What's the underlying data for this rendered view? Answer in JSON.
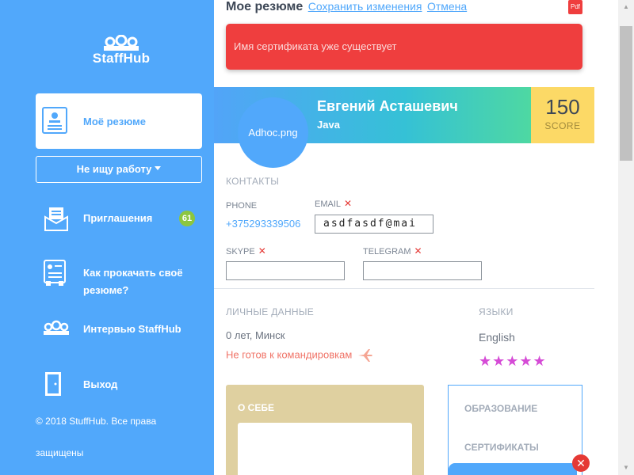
{
  "brand": {
    "name": "StaffHub"
  },
  "sidebar": {
    "items": [
      {
        "label": "Моё резюме",
        "icon": "resume-icon"
      },
      {
        "label": "Приглашения",
        "icon": "invitations-icon",
        "badge": "61"
      },
      {
        "label": "Как прокачать своё резюме?",
        "icon": "boost-resume-icon"
      },
      {
        "label": "Интервью StaffHub",
        "icon": "interview-icon"
      },
      {
        "label": "Выход",
        "icon": "exit-door-icon"
      }
    ],
    "status_select": "Не ищу работу",
    "footer": "© 2018 StuffHub. Все права защищены"
  },
  "header": {
    "title": "Мое резюме",
    "save_link": "Сохранить изменения",
    "cancel_link": "Отмена",
    "pdf_label": "Pdf"
  },
  "alert": {
    "message": "Имя сертификата уже существует"
  },
  "profile": {
    "avatar_text": "Adhoc.png",
    "name": "Евгений Асташевич",
    "specialty": "Java",
    "score": "150",
    "score_label": "SCORE"
  },
  "contacts": {
    "title": "КОНТАКТЫ",
    "phone_label": "PHONE",
    "phone_value": "+375293339506",
    "email_label": "EMAIL",
    "email_value": "asdfasdf@mai",
    "skype_label": "SKYPE",
    "skype_value": "",
    "telegram_label": "TELEGRAM",
    "telegram_value": ""
  },
  "personal": {
    "title": "ЛИЧНЫЕ ДАННЫЕ",
    "age_city": "0 лет, Минск",
    "travel": "Не готов к командировкам"
  },
  "languages": {
    "title": "ЯЗЫКИ",
    "items": [
      {
        "name": "English",
        "stars": "★★★★★",
        "rating": 5
      }
    ]
  },
  "about": {
    "title": "О СЕБЕ",
    "text": ""
  },
  "sections_menu": {
    "items": [
      "ОБРАЗОВАНИЕ",
      "СЕРТИФИКАТЫ"
    ]
  },
  "colors": {
    "sidebar": "#51a8fb",
    "alert": "#ef3e3e",
    "score": "#fcd966",
    "badge": "#8cc63f",
    "stars": "#d54bd6",
    "about_card": "#dfd0a0"
  }
}
